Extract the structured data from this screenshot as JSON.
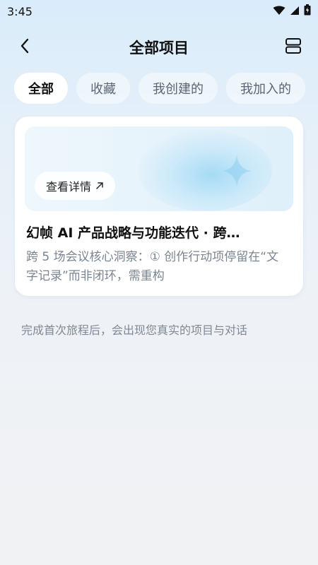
{
  "status_bar": {
    "time": "3:45",
    "icons": [
      "wifi-icon",
      "signal-icon",
      "battery-icon"
    ]
  },
  "header": {
    "title": "全部项目",
    "back_icon": "chevron-left-icon",
    "layout_icon": "layout-rows-icon"
  },
  "tabs": [
    {
      "label": "全部",
      "active": true
    },
    {
      "label": "收藏",
      "active": false
    },
    {
      "label": "我创建的",
      "active": false
    },
    {
      "label": "我加入的",
      "active": false
    }
  ],
  "card": {
    "detail_label": "查看详情",
    "detail_icon": "arrow-up-right-icon",
    "title": "幻帧 AI 产品战略与功能迭代 · 跨…",
    "description": "跨 5 场会议核心洞察：① 创作行动项停留在“文字记录”而非闭环，需重构"
  },
  "empty_hint": "完成首次旅程后，会出现您真实的项目与对话",
  "colors": {
    "background_top": "#d9ecfb",
    "background_bottom": "#f1f2f4",
    "tab_active_bg": "#ffffff",
    "muted_text": "#7b8592"
  }
}
